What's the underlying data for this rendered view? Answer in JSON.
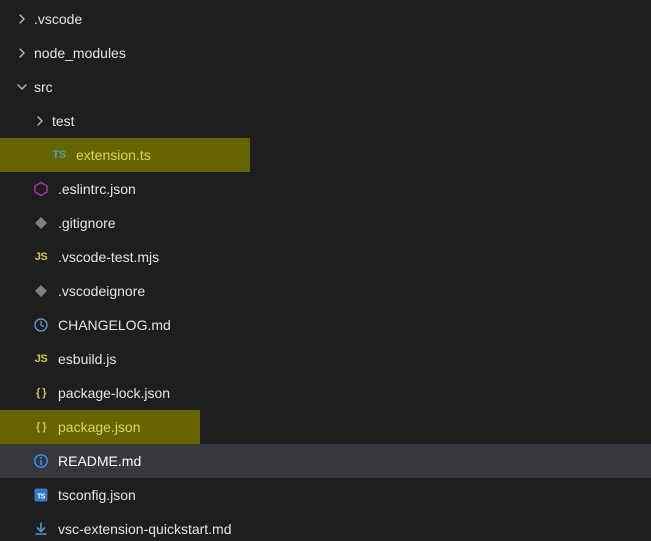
{
  "tree": [
    {
      "name": ".vscode",
      "type": "folder",
      "depth": 0,
      "expanded": false
    },
    {
      "name": "node_modules",
      "type": "folder",
      "depth": 0,
      "expanded": false
    },
    {
      "name": "src",
      "type": "folder",
      "depth": 0,
      "expanded": true
    },
    {
      "name": "test",
      "type": "folder",
      "depth": 1,
      "expanded": false
    },
    {
      "name": "extension.ts",
      "type": "file",
      "depth": 1,
      "icon": "ts",
      "highlighted": true,
      "highlightWidth": 250
    },
    {
      "name": ".eslintrc.json",
      "type": "file",
      "depth": 0,
      "icon": "eslint"
    },
    {
      "name": ".gitignore",
      "type": "file",
      "depth": 0,
      "icon": "git"
    },
    {
      "name": ".vscode-test.mjs",
      "type": "file",
      "depth": 0,
      "icon": "js"
    },
    {
      "name": ".vscodeignore",
      "type": "file",
      "depth": 0,
      "icon": "git"
    },
    {
      "name": "CHANGELOG.md",
      "type": "file",
      "depth": 0,
      "icon": "changelog"
    },
    {
      "name": "esbuild.js",
      "type": "file",
      "depth": 0,
      "icon": "js"
    },
    {
      "name": "package-lock.json",
      "type": "file",
      "depth": 0,
      "icon": "brace"
    },
    {
      "name": "package.json",
      "type": "file",
      "depth": 0,
      "icon": "brace",
      "highlighted": true,
      "highlightWidth": 200
    },
    {
      "name": "README.md",
      "type": "file",
      "depth": 0,
      "icon": "info",
      "selected": true
    },
    {
      "name": "tsconfig.json",
      "type": "file",
      "depth": 0,
      "icon": "tsconfig"
    },
    {
      "name": "vsc-extension-quickstart.md",
      "type": "file",
      "depth": 0,
      "icon": "download"
    }
  ],
  "icons": {
    "ts": {
      "kind": "text",
      "text": "TS",
      "class": "c-ts"
    },
    "js": {
      "kind": "text",
      "text": "JS",
      "class": "c-js"
    },
    "eslint": {
      "kind": "svg",
      "svg": "hex",
      "class": "c-json-folder"
    },
    "git": {
      "kind": "svg",
      "svg": "diamond",
      "class": "c-gray"
    },
    "changelog": {
      "kind": "svg",
      "svg": "clock",
      "class": "c-blue"
    },
    "brace": {
      "kind": "text",
      "text": "{ }",
      "class": "c-brace"
    },
    "info": {
      "kind": "svg",
      "svg": "info",
      "class": "c-info"
    },
    "tsconfig": {
      "kind": "svg",
      "svg": "tsbox",
      "class": "c-tsconfig"
    },
    "download": {
      "kind": "svg",
      "svg": "down",
      "class": "c-blue"
    }
  }
}
